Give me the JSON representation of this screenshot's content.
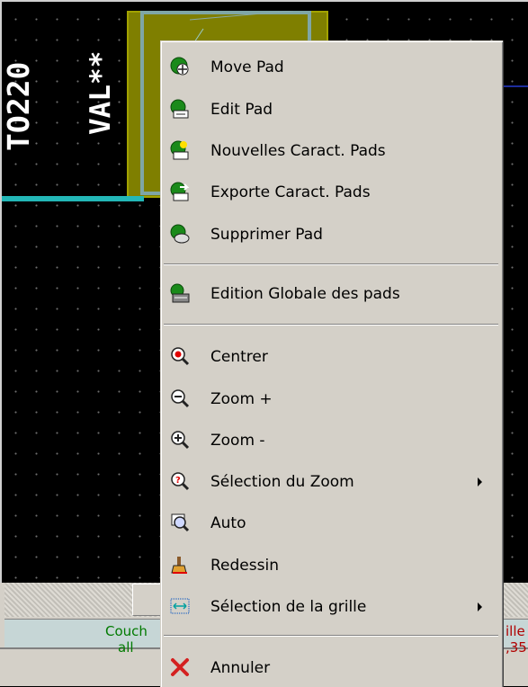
{
  "canvas": {
    "ref_text": "TO220",
    "val_text": "VAL**",
    "colors": {
      "background": "#000000",
      "pad": "#7f7f00",
      "track": "#23b7b7",
      "grid": "#6e6e6e",
      "axis": "#1d2c9c"
    }
  },
  "menu": {
    "items": [
      {
        "label": "Move Pad",
        "icon": "move-pad-icon"
      },
      {
        "label": "Edit Pad",
        "icon": "edit-pad-icon"
      },
      {
        "label": "Nouvelles Caract. Pads",
        "icon": "new-pad-settings-icon"
      },
      {
        "label": "Exporte Caract. Pads",
        "icon": "export-pad-settings-icon"
      },
      {
        "label": "Supprimer Pad",
        "icon": "delete-pad-icon"
      },
      {
        "label": "Edition Globale des pads",
        "icon": "global-pad-edit-icon"
      },
      {
        "label": "Centrer",
        "icon": "center-icon"
      },
      {
        "label": "Zoom +",
        "icon": "zoom-in-icon"
      },
      {
        "label": "Zoom -",
        "icon": "zoom-out-icon"
      },
      {
        "label": "Sélection du Zoom",
        "icon": "zoom-select-icon",
        "submenu": true
      },
      {
        "label": "Auto",
        "icon": "zoom-auto-icon"
      },
      {
        "label": "Redessin",
        "icon": "redraw-icon"
      },
      {
        "label": "Sélection de la grille",
        "icon": "grid-select-icon",
        "submenu": true
      },
      {
        "label": "Annuler",
        "icon": "cancel-icon"
      }
    ]
  },
  "status": {
    "couche_label": "Couch",
    "couche_value": "all",
    "right_label": "ille",
    "right_value": ",35"
  }
}
